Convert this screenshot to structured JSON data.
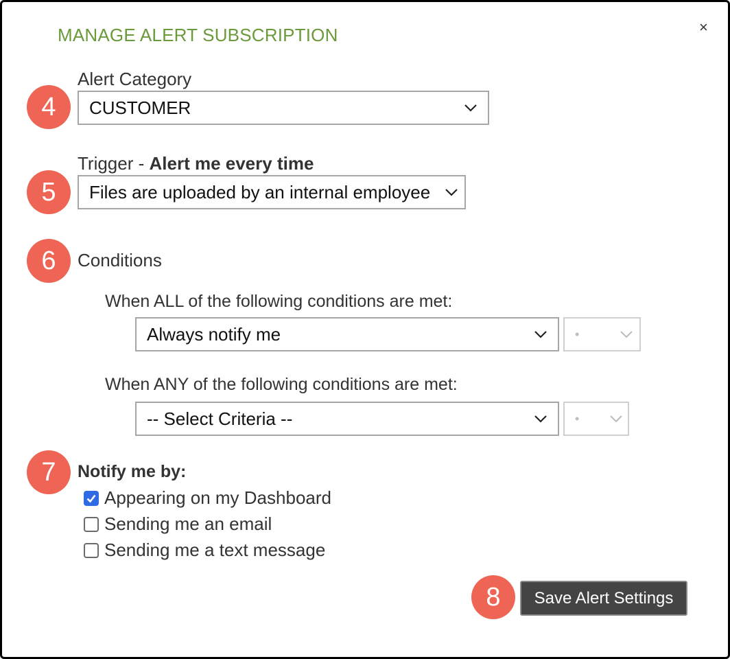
{
  "dialog": {
    "title": "MANAGE ALERT SUBSCRIPTION",
    "close_symbol": "×"
  },
  "steps": {
    "category": "4",
    "trigger": "5",
    "conditions": "6",
    "notify": "7",
    "save": "8"
  },
  "category": {
    "label": "Alert Category",
    "value": "CUSTOMER"
  },
  "trigger": {
    "label_prefix": "Trigger - ",
    "label_bold": "Alert me every time",
    "value": "Files are uploaded by an internal employee"
  },
  "conditions": {
    "label": "Conditions",
    "all_label": "When ALL of the following conditions are met:",
    "all_value": "Always notify me",
    "all_secondary": "•",
    "any_label": "When ANY of the following conditions are met:",
    "any_value": "-- Select Criteria --",
    "any_secondary": "•"
  },
  "notify": {
    "label": "Notify me by:",
    "options": [
      {
        "label": "Appearing on my Dashboard",
        "checked": true
      },
      {
        "label": "Sending me an email",
        "checked": false
      },
      {
        "label": "Sending me a text message",
        "checked": false
      }
    ]
  },
  "save_button": "Save Alert Settings",
  "colors": {
    "title": "#6a9a3a",
    "badge": "#ee6556",
    "button": "#444444",
    "checkbox_checked": "#2f6ae5"
  },
  "icons": {
    "close": "close-icon",
    "dropdown": "chevron-down-icon",
    "check": "checkmark-icon"
  }
}
